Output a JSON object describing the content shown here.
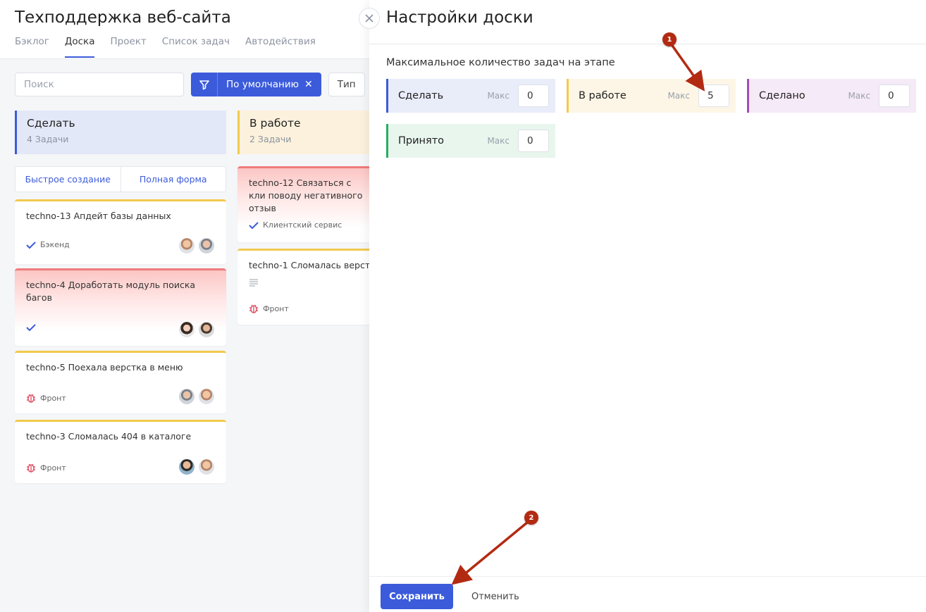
{
  "board": {
    "title": "Техподдержка веб-сайта",
    "tabs": [
      {
        "label": "Бэклог"
      },
      {
        "label": "Доска"
      },
      {
        "label": "Проект"
      },
      {
        "label": "Список задач"
      },
      {
        "label": "Автодействия"
      }
    ],
    "search_placeholder": "Поиск",
    "filter_label": "По умолчанию",
    "type_label": "Тип",
    "quick_create": "Быстрое создание",
    "full_form": "Полная форма",
    "columns": [
      {
        "name": "Сделать",
        "count": "4 Задачи",
        "color": "#3b5bdb",
        "bg": "#e3e8f8"
      },
      {
        "name": "В работе",
        "count": "2 Задачи",
        "color": "#f2c94c",
        "bg": "#fbf1dc"
      }
    ],
    "cards": [
      {
        "key": "techno-13",
        "title": "Апдейт базы данных",
        "tag": "Бэкенд"
      },
      {
        "key": "techno-4",
        "title": "Доработать модуль поиска багов",
        "tag": ""
      },
      {
        "key": "techno-5",
        "title": "Поехала верстка в меню",
        "tag": "Фронт"
      },
      {
        "key": "techno-3",
        "title": "Сломалась 404 в каталоге",
        "tag": "Фронт"
      },
      {
        "key": "techno-12",
        "title": "Связаться с кли поводу негативного отзыв",
        "tag": "Клиентский сервис"
      },
      {
        "key": "techno-1",
        "title": "Сломалась верст",
        "tag": "Фронт"
      }
    ]
  },
  "panel": {
    "title": "Настройки доски",
    "section_label": "Максимальное количество задач на этапе",
    "max_label": "Макс",
    "stages": [
      {
        "name": "Сделать",
        "value": "0",
        "color": "#3b5bdb",
        "bg": "#e9ecf9"
      },
      {
        "name": "В работе",
        "value": "5",
        "color": "#f2c94c",
        "bg": "#fdf6e6"
      },
      {
        "name": "Сделано",
        "value": "0",
        "color": "#a04db8",
        "bg": "#f5eaf7"
      },
      {
        "name": "Принято",
        "value": "0",
        "color": "#27ae60",
        "bg": "#e8f6ee"
      }
    ],
    "save_label": "Сохранить",
    "cancel_label": "Отменить"
  },
  "annotations": [
    {
      "label": "1"
    },
    {
      "label": "2"
    }
  ],
  "colors": {
    "accent": "#3b5bdb",
    "annotation": "#b32a12"
  }
}
